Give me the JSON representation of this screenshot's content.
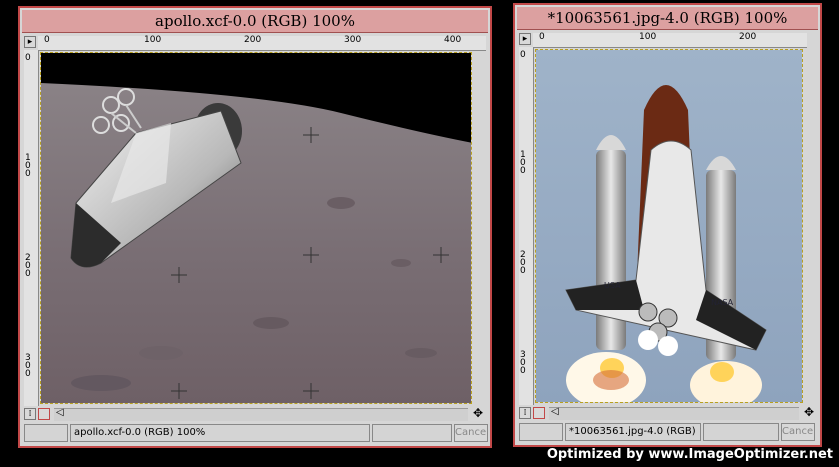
{
  "windows": [
    {
      "title": "apollo.xcf-0.0 (RGB) 100%",
      "ruler_h": [
        "0",
        "100",
        "200",
        "300",
        "400"
      ],
      "ruler_v": [
        "0",
        "100",
        "200",
        "300"
      ],
      "status": "apollo.xcf-0.0 (RGB) 100%",
      "cancel": "Cancel"
    },
    {
      "title": "*10063561.jpg-4.0 (RGB) 100%",
      "ruler_h": [
        "0",
        "100",
        "200"
      ],
      "ruler_v": [
        "0",
        "100",
        "200",
        "300"
      ],
      "status": "*10063561.jpg-4.0 (RGB)",
      "cancel": "Cancel"
    }
  ],
  "footer": "Optimized by www.ImageOptimizer.net",
  "colors": {
    "title_bg": "#dca0a0",
    "window_border": "#c24848"
  }
}
